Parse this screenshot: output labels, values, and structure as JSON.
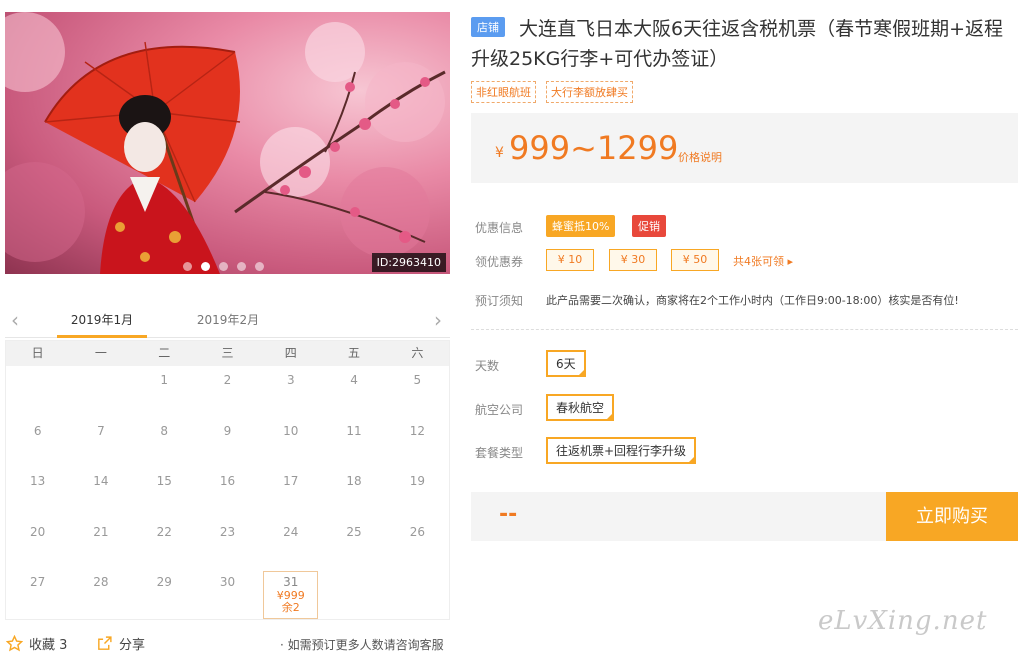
{
  "hero": {
    "id_label": "ID:2963410",
    "dots": 5,
    "active_dot": 1
  },
  "calendar": {
    "months": [
      "2019年1月",
      "2019年2月"
    ],
    "weekdays": [
      "日",
      "一",
      "二",
      "三",
      "四",
      "五",
      "六"
    ],
    "days": [
      "",
      "",
      "1",
      "2",
      "3",
      "4",
      "5",
      "6",
      "7",
      "8",
      "9",
      "10",
      "11",
      "12",
      "13",
      "14",
      "15",
      "16",
      "17",
      "18",
      "19",
      "20",
      "21",
      "22",
      "23",
      "24",
      "25",
      "26",
      "27",
      "28",
      "29",
      "30",
      "31",
      "",
      ""
    ],
    "active_day": {
      "day": "31",
      "price": "¥999",
      "stock": "余2"
    }
  },
  "footer": {
    "favorite_label": "收藏 3",
    "share_label": "分享",
    "contact_text": "· 如需预订更多人数请咨询客服"
  },
  "product": {
    "shop_badge": "店铺",
    "title": "大连直飞日本大阪6天往返含税机票（春节寒假班期+返程升级25KG行李+可代办签证）",
    "tags": [
      "非红眼航班",
      "大行李额放肆买"
    ],
    "price_symbol": "¥",
    "price_range": "999~1299",
    "price_note": "价格说明"
  },
  "offers": {
    "label": "优惠信息",
    "promo_a": "蜂蜜抵10%",
    "promo_b": "促销",
    "coupon_label": "领优惠券",
    "coupons": [
      "¥ 10",
      "¥ 30",
      "¥ 50"
    ],
    "coupon_more": "共4张可领 ▸",
    "notice_label": "预订须知",
    "notice_text": "此产品需要二次确认，商家将在2个工作小时内（工作日9:00-18:00）核实是否有位!"
  },
  "options": {
    "days_label": "天数",
    "days_value": "6天",
    "airline_label": "航空公司",
    "airline_value": "春秋航空",
    "package_label": "套餐类型",
    "package_value": "往返机票+回程行李升级"
  },
  "buy": {
    "total_placeholder": "--",
    "button_label": "立即购买"
  },
  "watermark": "eLvXing.net",
  "colors": {
    "accent": "#f8a724",
    "price": "#f07a22",
    "badge_blue": "#5b9cf0",
    "promo_red": "#e8483b"
  }
}
